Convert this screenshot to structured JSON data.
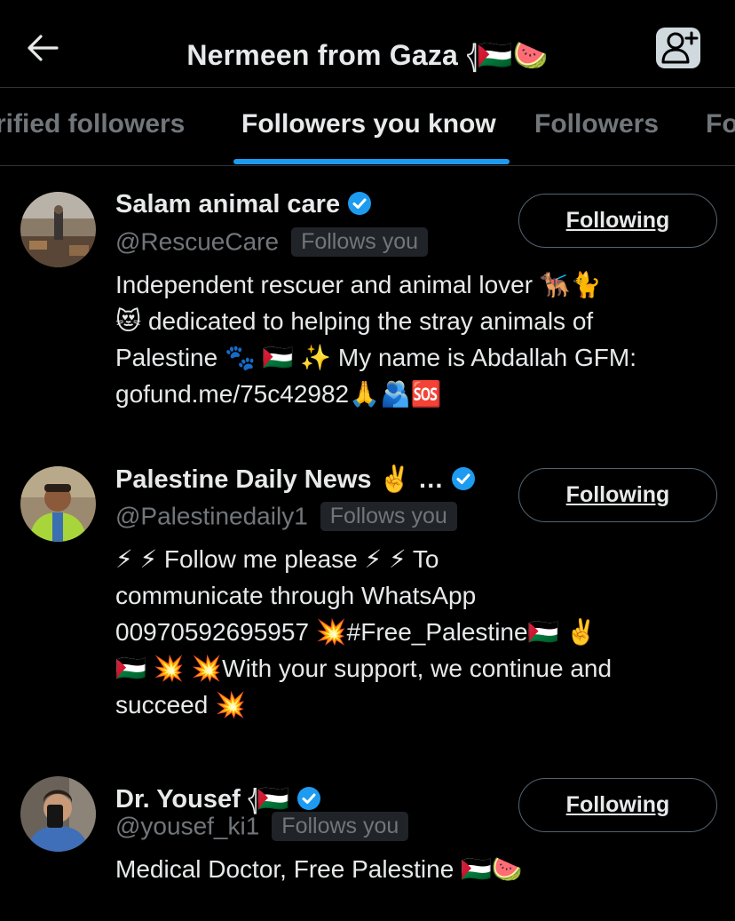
{
  "header": {
    "title": "Nermeen from Gaza 𓂆🇵🇸🍉"
  },
  "tabs": [
    {
      "label": "rified followers"
    },
    {
      "label": "Followers you know"
    },
    {
      "label": "Followers"
    },
    {
      "label": "Fo"
    }
  ],
  "users": [
    {
      "name": "Salam animal care",
      "handle": "@RescueCare",
      "badge": "Follows you",
      "button": "Following",
      "bio_lines": [
        "Independent rescuer and animal lover 🐕‍🦺🐈",
        "😻 dedicated to helping the stray animals of",
        "Palestine 🐾 🇵🇸 ✨ My name is Abdallah GFM:",
        "gofund.me/75c42982🙏🫂🆘"
      ]
    },
    {
      "name": "Palestine Daily News ✌️ …",
      "handle": "@Palestinedaily1",
      "badge": "Follows you",
      "button": "Following",
      "bio_lines": [
        "⚡ ⚡ Follow me please ⚡ ⚡ To",
        "communicate through WhatsApp",
        "00970592695957 💥#Free_Palestine🇵🇸 ✌️",
        "🇵🇸 💥 💥With your support, we continue and",
        "succeed 💥"
      ]
    },
    {
      "name": "Dr. Yousef 𓂆🇵🇸",
      "handle": "@yousef_ki1",
      "badge": "Follows you",
      "button": "Following",
      "bio_lines": [
        "Medical Doctor, Free Palestine 🇵🇸🍉"
      ]
    }
  ],
  "icons": {
    "back": "arrow-left-icon",
    "add_user": "add-user-icon",
    "verified": "verified-badge-icon"
  },
  "colors": {
    "background": "#000000",
    "accent": "#1d9bf0",
    "text": "#e7e9ea",
    "muted": "#71767b"
  }
}
